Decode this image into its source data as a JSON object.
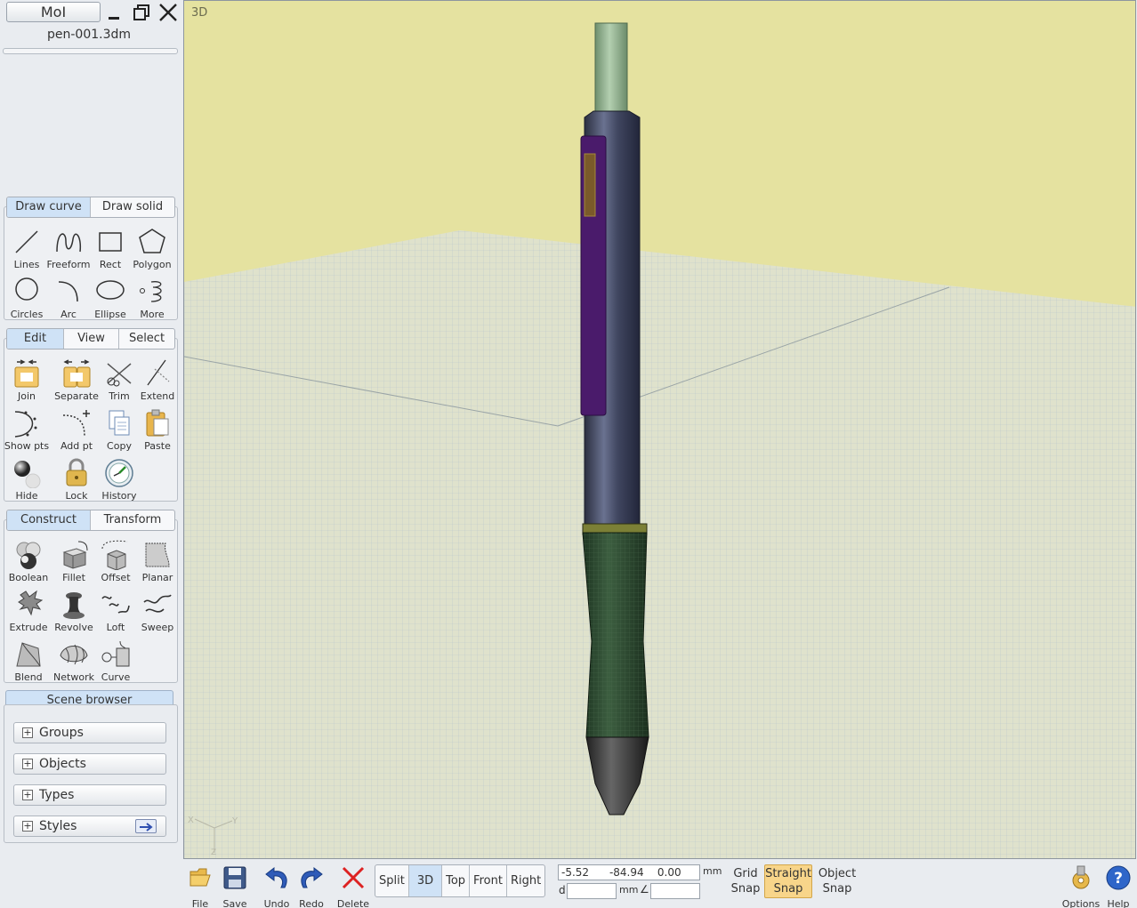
{
  "app": {
    "name": "MoI",
    "filename": "pen-001.3dm"
  },
  "window_controls": [
    "minimize-icon",
    "restore-icon",
    "close-icon"
  ],
  "draw_panel": {
    "tabs": [
      {
        "label": "Draw curve",
        "active": true
      },
      {
        "label": "Draw solid",
        "active": false
      }
    ],
    "tools": [
      {
        "label": "Lines",
        "icon": "line-icon"
      },
      {
        "label": "Freeform",
        "icon": "freeform-curve-icon"
      },
      {
        "label": "Rect",
        "icon": "rectangle-icon"
      },
      {
        "label": "Polygon",
        "icon": "polygon-icon"
      },
      {
        "label": "Circles",
        "icon": "circle-icon"
      },
      {
        "label": "Arc",
        "icon": "arc-icon"
      },
      {
        "label": "Ellipse",
        "icon": "ellipse-icon"
      },
      {
        "label": "More",
        "icon": "more-curves-icon"
      }
    ]
  },
  "edit_panel": {
    "tabs": [
      {
        "label": "Edit",
        "active": true
      },
      {
        "label": "View",
        "active": false
      },
      {
        "label": "Select",
        "active": false
      }
    ],
    "tools": [
      {
        "label": "Join",
        "icon": "join-icon"
      },
      {
        "label": "Separate",
        "icon": "separate-icon"
      },
      {
        "label": "Trim",
        "icon": "scissors-icon"
      },
      {
        "label": "Extend",
        "icon": "extend-icon"
      },
      {
        "label": "Show pts",
        "icon": "show-points-icon"
      },
      {
        "label": "Add pt",
        "icon": "add-point-icon"
      },
      {
        "label": "Copy",
        "icon": "copy-icon"
      },
      {
        "label": "Paste",
        "icon": "paste-icon"
      },
      {
        "label": "Hide",
        "icon": "hide-icon"
      },
      {
        "label": "Lock",
        "icon": "lock-icon"
      },
      {
        "label": "History",
        "icon": "history-icon"
      }
    ]
  },
  "construct_panel": {
    "tabs": [
      {
        "label": "Construct",
        "active": true
      },
      {
        "label": "Transform",
        "active": false
      }
    ],
    "tools": [
      {
        "label": "Boolean",
        "icon": "boolean-icon"
      },
      {
        "label": "Fillet",
        "icon": "fillet-icon"
      },
      {
        "label": "Offset",
        "icon": "offset-icon"
      },
      {
        "label": "Planar",
        "icon": "planar-icon"
      },
      {
        "label": "Extrude",
        "icon": "extrude-icon"
      },
      {
        "label": "Revolve",
        "icon": "revolve-icon"
      },
      {
        "label": "Loft",
        "icon": "loft-icon"
      },
      {
        "label": "Sweep",
        "icon": "sweep-icon"
      },
      {
        "label": "Blend",
        "icon": "blend-icon"
      },
      {
        "label": "Network",
        "icon": "network-icon"
      },
      {
        "label": "Curve",
        "icon": "curve-icon"
      }
    ]
  },
  "scene_browser": {
    "title": "Scene browser",
    "items": [
      {
        "label": "Groups"
      },
      {
        "label": "Objects"
      },
      {
        "label": "Types"
      },
      {
        "label": "Styles"
      }
    ]
  },
  "viewport": {
    "label": "3D",
    "axis_labels": {
      "x": "X",
      "y": "Y",
      "z": "Z"
    },
    "colors": {
      "background": "#e5e2a0",
      "grid": "#b9c6cc",
      "pen_body": "#40465a",
      "pen_grip": "#2b4a2e",
      "pen_clip": "#4b1a6e",
      "pen_cap": "#8fb08e"
    }
  },
  "bottom_bar": {
    "tools": [
      {
        "label": "File",
        "icon": "folder-icon"
      },
      {
        "label": "Save",
        "icon": "save-icon"
      },
      {
        "label": "Undo",
        "icon": "undo-icon"
      },
      {
        "label": "Redo",
        "icon": "redo-icon"
      },
      {
        "label": "Delete",
        "icon": "delete-icon"
      }
    ],
    "views": [
      {
        "label": "Split",
        "active": false
      },
      {
        "label": "3D",
        "active": true
      },
      {
        "label": "Top",
        "active": false
      },
      {
        "label": "Front",
        "active": false
      },
      {
        "label": "Right",
        "active": false
      }
    ],
    "coords": {
      "x": "-5.52",
      "y": "-84.94",
      "z": "0.00",
      "unit": "mm",
      "d_label": "d",
      "d_value": "",
      "d_unit": "mm",
      "angle_value": ""
    },
    "snaps": [
      {
        "line1": "Grid",
        "line2": "Snap",
        "active": false
      },
      {
        "line1": "Straight",
        "line2": "Snap",
        "active": true
      },
      {
        "line1": "Object",
        "line2": "Snap",
        "active": false
      }
    ],
    "right_tools": [
      {
        "label": "Options",
        "icon": "options-icon"
      },
      {
        "label": "Help",
        "icon": "help-icon"
      }
    ]
  }
}
